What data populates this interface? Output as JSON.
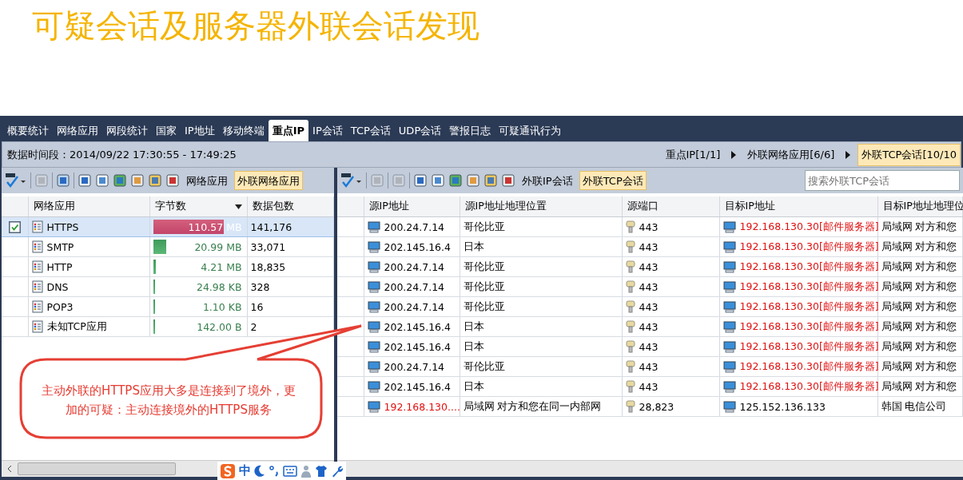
{
  "title": "可疑会话及服务器外联会话发现",
  "tabs": [
    {
      "label": "概要统计",
      "selected": false
    },
    {
      "label": "网络应用",
      "selected": false
    },
    {
      "label": "网段统计",
      "selected": false
    },
    {
      "label": "国家",
      "selected": false
    },
    {
      "label": "IP地址",
      "selected": false
    },
    {
      "label": "移动终端",
      "selected": false
    },
    {
      "label": "重点IP",
      "selected": true
    },
    {
      "label": "IP会话",
      "selected": false
    },
    {
      "label": "TCP会话",
      "selected": false
    },
    {
      "label": "UDP会话",
      "selected": false
    },
    {
      "label": "警报日志",
      "selected": false
    },
    {
      "label": "可疑通讯行为",
      "selected": false
    }
  ],
  "time_range": "数据时间段：2014/09/22  17:30:55 - 17:49:25",
  "breadcrumb": [
    {
      "label": "重点IP[1/1]",
      "selected": false
    },
    {
      "label": "外联网络应用[6/6]",
      "selected": false
    },
    {
      "label": "外联TCP会话[10/10",
      "selected": true
    }
  ],
  "left_panel": {
    "toolbar_buttons": [
      {
        "label": "网络应用",
        "selected": false
      },
      {
        "label": "外联网络应用",
        "selected": true
      }
    ],
    "columns": [
      "网络应用",
      "字节数",
      "数据包数"
    ],
    "rows": [
      {
        "checked": true,
        "selected": true,
        "app": "HTTPS",
        "bytes": "110.57 MB",
        "level": 0.78,
        "packets": "141,176"
      },
      {
        "checked": false,
        "selected": false,
        "app": "SMTP",
        "bytes": "20.99 MB",
        "level": 0.15,
        "packets": "33,071"
      },
      {
        "checked": false,
        "selected": false,
        "app": "HTTP",
        "bytes": "4.21 MB",
        "level": 0.03,
        "packets": "18,835"
      },
      {
        "checked": false,
        "selected": false,
        "app": "DNS",
        "bytes": "24.98 KB",
        "level": 0.01,
        "packets": "328"
      },
      {
        "checked": false,
        "selected": false,
        "app": "POP3",
        "bytes": "1.10 KB",
        "level": 0.01,
        "packets": "16"
      },
      {
        "checked": false,
        "selected": false,
        "app": "未知TCP应用",
        "bytes": "142.00 B",
        "level": 0.01,
        "packets": "2"
      }
    ]
  },
  "right_panel": {
    "toolbar_buttons": [
      {
        "label": "外联IP会话",
        "selected": false
      },
      {
        "label": "外联TCP会话",
        "selected": true
      }
    ],
    "search": {
      "placeholder": "搜索外联TCP会话"
    },
    "columns": [
      "源IP地址",
      "源IP地址地理位置",
      "源端口",
      "目标IP地址",
      "目标IP地址地理位"
    ],
    "rows": [
      {
        "src_ip": "200.24.7.14",
        "src_internal": false,
        "src_geo": "哥伦比亚",
        "port": "443",
        "dst_ip": "192.168.130.30[邮件服务器]",
        "dst_internal": true,
        "dst_geo": "局域网 对方和您"
      },
      {
        "src_ip": "202.145.16.4",
        "src_internal": false,
        "src_geo": "日本",
        "port": "443",
        "dst_ip": "192.168.130.30[邮件服务器]",
        "dst_internal": true,
        "dst_geo": "局域网 对方和您"
      },
      {
        "src_ip": "200.24.7.14",
        "src_internal": false,
        "src_geo": "哥伦比亚",
        "port": "443",
        "dst_ip": "192.168.130.30[邮件服务器]",
        "dst_internal": true,
        "dst_geo": "局域网 对方和您"
      },
      {
        "src_ip": "200.24.7.14",
        "src_internal": false,
        "src_geo": "哥伦比亚",
        "port": "443",
        "dst_ip": "192.168.130.30[邮件服务器]",
        "dst_internal": true,
        "dst_geo": "局域网 对方和您"
      },
      {
        "src_ip": "200.24.7.14",
        "src_internal": false,
        "src_geo": "哥伦比亚",
        "port": "443",
        "dst_ip": "192.168.130.30[邮件服务器]",
        "dst_internal": true,
        "dst_geo": "局域网 对方和您"
      },
      {
        "src_ip": "202.145.16.4",
        "src_internal": false,
        "src_geo": "日本",
        "port": "443",
        "dst_ip": "192.168.130.30[邮件服务器]",
        "dst_internal": true,
        "dst_geo": "局域网 对方和您"
      },
      {
        "src_ip": "202.145.16.4",
        "src_internal": false,
        "src_geo": "日本",
        "port": "443",
        "dst_ip": "192.168.130.30[邮件服务器]",
        "dst_internal": true,
        "dst_geo": "局域网 对方和您"
      },
      {
        "src_ip": "200.24.7.14",
        "src_internal": false,
        "src_geo": "哥伦比亚",
        "port": "443",
        "dst_ip": "192.168.130.30[邮件服务器]",
        "dst_internal": true,
        "dst_geo": "局域网 对方和您"
      },
      {
        "src_ip": "202.145.16.4",
        "src_internal": false,
        "src_geo": "日本",
        "port": "443",
        "dst_ip": "192.168.130.30[邮件服务器]",
        "dst_internal": true,
        "dst_geo": "局域网 对方和您"
      },
      {
        "src_ip": "192.168.130....",
        "src_internal": true,
        "src_geo": "局域网 对方和您在同一内部网",
        "port": "28,823",
        "dst_ip": "125.152.136.133",
        "dst_internal": false,
        "dst_geo": "韩国 电信公司"
      }
    ]
  },
  "callout": {
    "text": "主动外联的HTTPS应用大多是连接到了境外，更加的可疑：主动连接境外的HTTPS服务"
  },
  "ime_bar": {
    "label": "中"
  }
}
